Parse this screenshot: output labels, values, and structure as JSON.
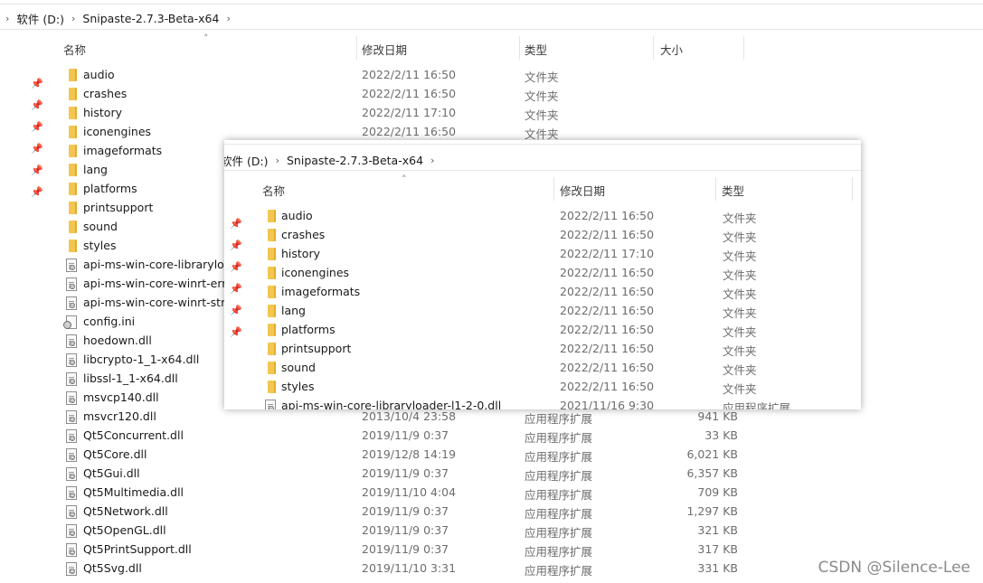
{
  "main": {
    "breadcrumb": {
      "drive": "软件 (D:)",
      "folder": "Snipaste-2.7.3-Beta-x64"
    },
    "columns": {
      "name": "名称",
      "date": "修改日期",
      "type": "类型",
      "size": "大小"
    },
    "rows": [
      {
        "name": "audio",
        "date": "2022/2/11 16:50",
        "type": "文件夹",
        "size": "",
        "icon": "folder"
      },
      {
        "name": "crashes",
        "date": "2022/2/11 16:50",
        "type": "文件夹",
        "size": "",
        "icon": "folder"
      },
      {
        "name": "history",
        "date": "2022/2/11 17:10",
        "type": "文件夹",
        "size": "",
        "icon": "folder"
      },
      {
        "name": "iconengines",
        "date": "2022/2/11 16:50",
        "type": "文件夹",
        "size": "",
        "icon": "folder"
      },
      {
        "name": "imageformats",
        "date": "",
        "type": "",
        "size": "",
        "icon": "folder"
      },
      {
        "name": "lang",
        "date": "",
        "type": "",
        "size": "",
        "icon": "folder"
      },
      {
        "name": "platforms",
        "date": "",
        "type": "",
        "size": "",
        "icon": "folder"
      },
      {
        "name": "printsupport",
        "date": "",
        "type": "",
        "size": "",
        "icon": "folder"
      },
      {
        "name": "sound",
        "date": "",
        "type": "",
        "size": "",
        "icon": "folder"
      },
      {
        "name": "styles",
        "date": "",
        "type": "",
        "size": "",
        "icon": "folder"
      },
      {
        "name": "api-ms-win-core-libraryloa",
        "date": "",
        "type": "",
        "size": "",
        "icon": "file"
      },
      {
        "name": "api-ms-win-core-winrt-erro",
        "date": "",
        "type": "",
        "size": "",
        "icon": "file"
      },
      {
        "name": "api-ms-win-core-winrt-strin",
        "date": "",
        "type": "",
        "size": "",
        "icon": "file"
      },
      {
        "name": "config.ini",
        "date": "",
        "type": "",
        "size": "",
        "icon": "ini"
      },
      {
        "name": "hoedown.dll",
        "date": "",
        "type": "",
        "size": "",
        "icon": "file"
      },
      {
        "name": "libcrypto-1_1-x64.dll",
        "date": "",
        "type": "",
        "size": "",
        "icon": "file"
      },
      {
        "name": "libssl-1_1-x64.dll",
        "date": "",
        "type": "",
        "size": "",
        "icon": "file"
      },
      {
        "name": "msvcp140.dll",
        "date": "",
        "type": "",
        "size": "",
        "icon": "file"
      },
      {
        "name": "msvcr120.dll",
        "date": "2013/10/4 23:58",
        "type": "应用程序扩展",
        "size": "941 KB",
        "icon": "file"
      },
      {
        "name": "Qt5Concurrent.dll",
        "date": "2019/11/9 0:37",
        "type": "应用程序扩展",
        "size": "33 KB",
        "icon": "file"
      },
      {
        "name": "Qt5Core.dll",
        "date": "2019/12/8 14:19",
        "type": "应用程序扩展",
        "size": "6,021 KB",
        "icon": "file"
      },
      {
        "name": "Qt5Gui.dll",
        "date": "2019/11/9 0:37",
        "type": "应用程序扩展",
        "size": "6,357 KB",
        "icon": "file"
      },
      {
        "name": "Qt5Multimedia.dll",
        "date": "2019/11/10 4:04",
        "type": "应用程序扩展",
        "size": "709 KB",
        "icon": "file"
      },
      {
        "name": "Qt5Network.dll",
        "date": "2019/11/9 0:37",
        "type": "应用程序扩展",
        "size": "1,297 KB",
        "icon": "file"
      },
      {
        "name": "Qt5OpenGL.dll",
        "date": "2019/11/9 0:37",
        "type": "应用程序扩展",
        "size": "321 KB",
        "icon": "file"
      },
      {
        "name": "Qt5PrintSupport.dll",
        "date": "2019/11/9 0:37",
        "type": "应用程序扩展",
        "size": "317 KB",
        "icon": "file"
      },
      {
        "name": "Qt5Svg.dll",
        "date": "2019/11/10 3:31",
        "type": "应用程序扩展",
        "size": "331 KB",
        "icon": "file"
      }
    ]
  },
  "overlay": {
    "breadcrumb": {
      "drive": "软件 (D:)",
      "folder": "Snipaste-2.7.3-Beta-x64"
    },
    "columns": {
      "name": "名称",
      "date": "修改日期",
      "type": "类型"
    },
    "rows": [
      {
        "name": "audio",
        "date": "2022/2/11 16:50",
        "type": "文件夹",
        "icon": "folder"
      },
      {
        "name": "crashes",
        "date": "2022/2/11 16:50",
        "type": "文件夹",
        "icon": "folder"
      },
      {
        "name": "history",
        "date": "2022/2/11 17:10",
        "type": "文件夹",
        "icon": "folder"
      },
      {
        "name": "iconengines",
        "date": "2022/2/11 16:50",
        "type": "文件夹",
        "icon": "folder"
      },
      {
        "name": "imageformats",
        "date": "2022/2/11 16:50",
        "type": "文件夹",
        "icon": "folder"
      },
      {
        "name": "lang",
        "date": "2022/2/11 16:50",
        "type": "文件夹",
        "icon": "folder"
      },
      {
        "name": "platforms",
        "date": "2022/2/11 16:50",
        "type": "文件夹",
        "icon": "folder"
      },
      {
        "name": "printsupport",
        "date": "2022/2/11 16:50",
        "type": "文件夹",
        "icon": "folder"
      },
      {
        "name": "sound",
        "date": "2022/2/11 16:50",
        "type": "文件夹",
        "icon": "folder"
      },
      {
        "name": "styles",
        "date": "2022/2/11 16:50",
        "type": "文件夹",
        "icon": "folder"
      },
      {
        "name": "api-ms-win-core-libraryloader-l1-2-0.dll",
        "date": "2021/11/16 9:30",
        "type": "应用程序扩展",
        "icon": "file"
      }
    ]
  },
  "watermark": "CSDN @Silence-Lee",
  "icons": {
    "pin": "pin-icon",
    "chevron": "chevron-right-icon",
    "sort": "sort-up-icon"
  },
  "colors": {
    "folder": "#f3c652",
    "muted_text": "#6d6d6d"
  }
}
